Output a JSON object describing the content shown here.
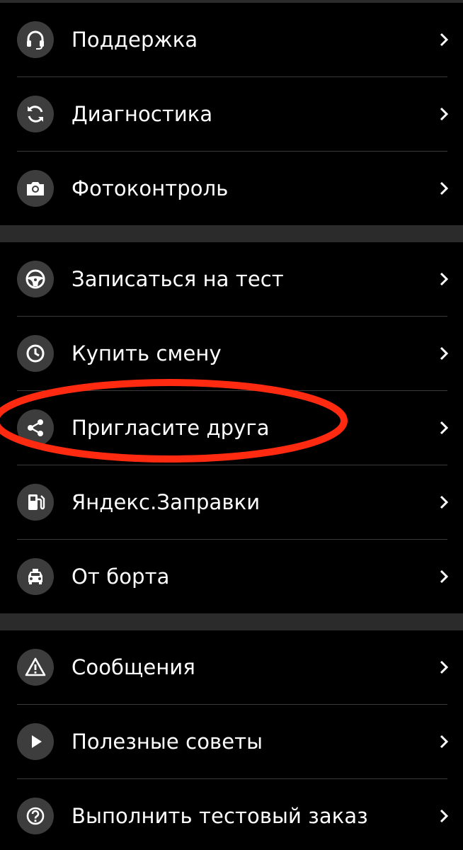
{
  "colors": {
    "background": "#000000",
    "icon_bg": "#3d3d3d",
    "divider": "#3a3a3a",
    "gap": "#2b2b2b",
    "highlight": "#ff2a10"
  },
  "sections": [
    {
      "items": [
        {
          "label": "Поддержка",
          "icon": "headset-icon"
        },
        {
          "label": "Диагностика",
          "icon": "refresh-icon"
        },
        {
          "label": "Фотоконтроль",
          "icon": "camera-icon"
        }
      ]
    },
    {
      "items": [
        {
          "label": "Записаться на тест",
          "icon": "steering-wheel-icon"
        },
        {
          "label": "Купить смену",
          "icon": "clock-icon"
        },
        {
          "label": "Пригласите друга",
          "icon": "share-icon"
        },
        {
          "label": "Яндекс.Заправки",
          "icon": "fuel-icon"
        },
        {
          "label": "От борта",
          "icon": "taxi-icon"
        }
      ]
    },
    {
      "items": [
        {
          "label": "Сообщения",
          "icon": "warning-icon"
        },
        {
          "label": "Полезные советы",
          "icon": "play-icon"
        },
        {
          "label": "Выполнить тестовый заказ",
          "icon": "help-icon"
        }
      ]
    }
  ]
}
